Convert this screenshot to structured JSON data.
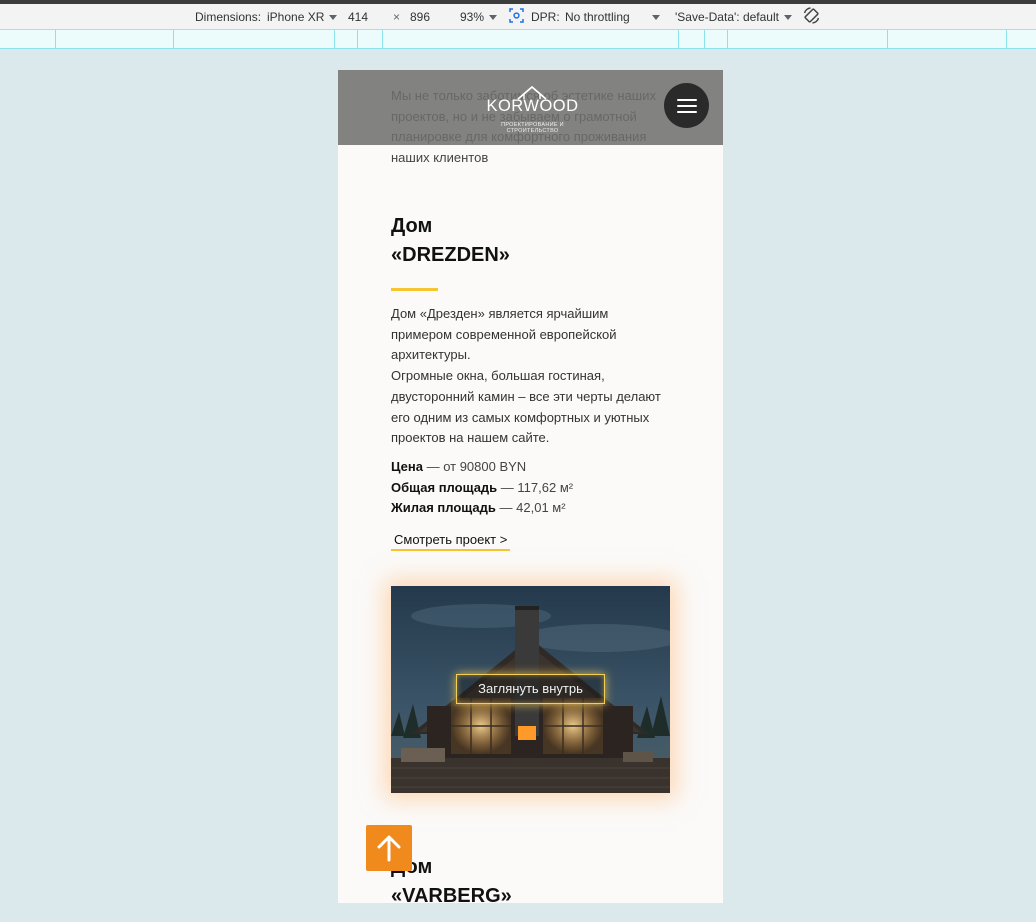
{
  "devtools": {
    "dimensions_label": "Dimensions:",
    "device": "iPhone XR",
    "width": "414",
    "times": "×",
    "height": "896",
    "zoom": "93%",
    "dpr_label": "DPR:",
    "throttling": "No throttling",
    "save_data": "'Save-Data': default"
  },
  "site": {
    "logo_word": "KORWOOD",
    "logo_sub": "ПРОЕКТИРОВАНИЕ И СТРОИТЕЛЬСТВО",
    "intro_text": "Мы не только заботимся об эстетике наших проектов, но и не забываем о грамотной планировке для комфортного проживания наших клиентов"
  },
  "project": {
    "title_line1": "Дом",
    "title_line2": "«DREZDEN»",
    "desc_p1": "Дом «Дрезден» является ярчайшим примером современной европейской архитектуры.",
    "desc_p2": "Огромные окна, большая гостиная, двусторонний камин – все эти черты делают его одним из самых комфортных и уютных проектов на нашем сайте.",
    "price_label": "Цена",
    "price_value": " — от 90800 BYN",
    "total_area_label": "Общая площадь",
    "total_area_value": " — 117,62 м²",
    "living_area_label": "Жилая площадь",
    "living_area_value": " — 42,01 м²",
    "view_link": "Смотреть проект >",
    "peek_button": "Заглянуть внутрь"
  },
  "next_project": {
    "title_line1": "Дом",
    "title_line2": "«VARBERG»"
  },
  "colors": {
    "accent_yellow": "#f6c532",
    "scroll_button": "#f08a1c",
    "page_bg": "#dbe9ec"
  }
}
